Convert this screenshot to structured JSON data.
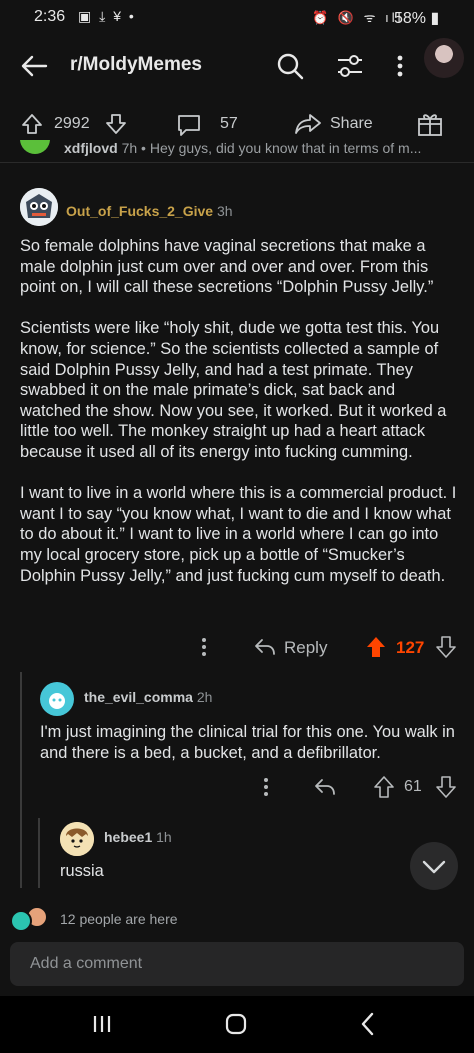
{
  "status_bar": {
    "time": "2:36",
    "battery": "58%"
  },
  "header": {
    "subreddit": "r/MoldyMemes"
  },
  "post_actions": {
    "upvotes": "2992",
    "comments": "57",
    "share": "Share"
  },
  "prev_comment": {
    "author": "xdfjlovd",
    "time": "7h",
    "separator": "•",
    "snippet": "Hey guys, did you know that in terms of m..."
  },
  "main_comment": {
    "author": "Out_of_Fucks_2_Give",
    "time": "3h",
    "paragraphs": [
      "So female dolphins have vaginal secretions that make a male dolphin just cum over and over and over. From this point on, I will call these secretions “Dolphin Pussy Jelly.”",
      "Scientists were like “holy shit, dude we gotta test this. You know, for science.” So the scientists collected a sample of said Dolphin Pussy Jelly, and had a test primate. They swabbed it on the male primate’s dick, sat back and watched the show. Now you see, it worked. But it worked a little too well. The monkey straight up had a heart attack because it used all of its energy into fucking cumming.",
      "I want to live in a world where this is a commercial product. I want I to say “you know what, I want to die and I know what to do about it.” I want to live in a world where I can go into my local grocery store, pick up a bottle of “Smucker’s Dolphin Pussy Jelly,” and just fucking cum myself to death."
    ],
    "reply_label": "Reply",
    "score": "127"
  },
  "reply1": {
    "author": "the_evil_comma",
    "time": "2h",
    "body": "I'm just imagining the clinical trial for this one. You walk in and there is a bed, a bucket, and a defibrillator.",
    "score": "61"
  },
  "reply2": {
    "author": "hebee1",
    "time": "1h",
    "body": "russia"
  },
  "presence": {
    "text": "12 people are here"
  },
  "composer": {
    "placeholder": "Add a comment"
  },
  "colors": {
    "accent_upvote": "#ff4500",
    "background": "#121212"
  }
}
